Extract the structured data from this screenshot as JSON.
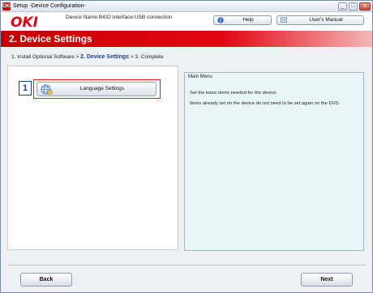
{
  "window": {
    "title": "Setup -Device Configuration-",
    "icon_text": "OKI",
    "controls": {
      "minimize": "_",
      "maximize": "□",
      "close": "x"
    }
  },
  "header": {
    "logo": "OKI",
    "device_info": "Device Name:B432 Interface:USB connection",
    "help_label": "Help",
    "manual_label": "User's Manual"
  },
  "banner": {
    "title": "2. Device Settings"
  },
  "steps": {
    "step1": "1. Install Optional Software >",
    "step2": "2. Device Settings",
    "step3": "> 3. Complete"
  },
  "tasks": [
    {
      "number": "1",
      "label": "Language Settings",
      "icon": "globe-icon"
    }
  ],
  "info_panel": {
    "title": "Main Menu",
    "line1": "Set the basic items needed for the device.",
    "line2": "Items already set on the device do not need to be set again on the DVD."
  },
  "footer": {
    "back_label": "Back",
    "next_label": "Next"
  },
  "colors": {
    "brand_red": "#e60012",
    "step_blue": "#1a3f8f",
    "panel_bg": "#e9f6f8",
    "highlight": "#e31b1b"
  }
}
